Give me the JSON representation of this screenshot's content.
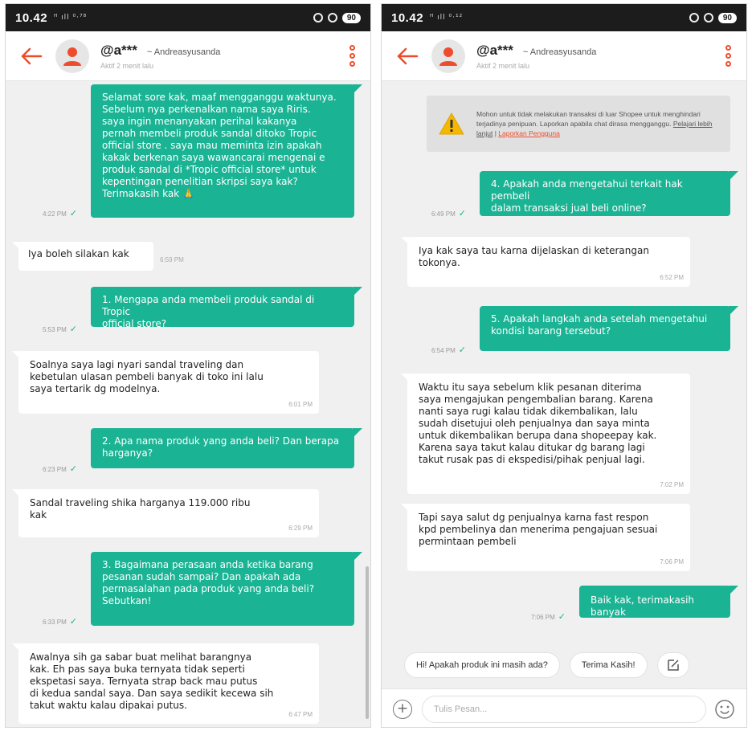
{
  "colors": {
    "brand": "#ee4d2d",
    "sent_bubble": "#1ab394",
    "background": "#f0f0f0"
  },
  "left": {
    "status_bar": {
      "time": "10.42",
      "signal": "ᴴ ıll ⁰·⁷⁸",
      "battery": "90"
    },
    "header": {
      "username": "@a***",
      "shop": "~ Andreasyusanda",
      "active": "Aktif 2 menit lalu"
    },
    "messages": [
      {
        "side": "sent",
        "text": "Selamat sore kak, maaf mengganggu waktunya.\nSebelum nya perkenalkan nama saya Riris.\nsaya ingin menanyakan perihal kakanya\npernah membeli produk sandal ditoko Tropic\nofficial store . saya mau meminta izin apakah\nkakak berkenan saya wawancarai mengenai e\nproduk sandal di *Tropic official store* untuk\nkepentingan penelitian skripsi saya kak?\nTerimakasih kak 🙏",
        "time": "4:22 PM"
      },
      {
        "side": "recv",
        "text": "Iya boleh silakan kak",
        "time": "6:59 PM"
      },
      {
        "side": "sent",
        "text": "1. Mengapa anda membeli produk sandal di Tropic\nofficial store?",
        "time": "5:53 PM"
      },
      {
        "side": "recv",
        "text": "Soalnya saya lagi nyari sandal traveling dan\nkebetulan ulasan pembeli banyak di toko ini lalu\nsaya tertarik dg modelnya.",
        "time": "6:01 PM"
      },
      {
        "side": "sent",
        "text": "2. Apa nama produk yang anda beli? Dan berapa\nharganya?",
        "time": "6:23 PM"
      },
      {
        "side": "recv",
        "text": "Sandal traveling shika harganya 119.000 ribu\nkak",
        "time": "6:29 PM"
      },
      {
        "side": "sent",
        "text": "3. Bagaimana perasaan anda ketika barang\npesanan sudah sampai? Dan apakah ada\npermasalahan pada produk yang anda beli?\nSebutkan!",
        "time": "6:33 PM"
      },
      {
        "side": "recv",
        "text": "Awalnya sih ga sabar buat melihat barangnya\nkak. Eh pas saya buka ternyata tidak seperti\nekspetasi saya. Ternyata strap back mau putus\ndi kedua sandal saya. Dan saya sedikit kecewa sih\ntakut waktu kalau dipakai putus.",
        "time": "6:47 PM"
      }
    ]
  },
  "right": {
    "status_bar": {
      "time": "10.42",
      "signal": "ᴴ ıll ⁰·¹²",
      "battery": "90"
    },
    "header": {
      "username": "@a***",
      "shop": "~ Andreasyusanda",
      "active": "Aktif 2 menit lalu"
    },
    "notice": {
      "text": "Mohon untuk tidak melakukan transaksi di luar Shopee untuk menghindari terjadinya penipuan. Laporkan apabila chat dirasa mengganggu.",
      "learn_more": "Pelajari lebih lanjut",
      "separator": " | ",
      "report": "Laporkan Pengguna"
    },
    "messages": [
      {
        "side": "sent",
        "text": "4. Apakah anda mengetahui terkait hak pembeli\ndalam transaksi jual beli online?",
        "time": "6:49 PM"
      },
      {
        "side": "recv",
        "text": "Iya kak saya tau karna dijelaskan di keterangan\ntokonya.",
        "time": "6:52 PM"
      },
      {
        "side": "sent",
        "text": "5. Apakah langkah anda setelah mengetahui\nkondisi barang tersebut?",
        "time": "6:54 PM"
      },
      {
        "side": "recv",
        "text": "Waktu itu saya sebelum klik pesanan diterima\nsaya mengajukan pengembalian barang. Karena\nnanti saya rugi kalau tidak dikembalikan, lalu\nsudah disetujui oleh penjualnya dan saya minta\nuntuk dikembalikan berupa dana shopeepay kak.\nKarena saya takut kalau ditukar dg barang lagi\ntakut rusak pas di ekspedisi/pihak penjual lagi.",
        "time": "7:02 PM"
      },
      {
        "side": "recv",
        "text": "Tapi saya salut dg penjualnya karna fast respon\nkpd pembelinya dan menerima pengajuan sesuai\npermintaan pembeli",
        "time": "7:06 PM"
      },
      {
        "side": "sent",
        "text": "Baik kak, terimakasih banyak",
        "time": "7:06 PM"
      }
    ],
    "quick_replies": [
      "Hi! Apakah produk ini masih ada?",
      "Terima Kasih!"
    ],
    "input": {
      "placeholder": "Tulis Pesan..."
    }
  }
}
